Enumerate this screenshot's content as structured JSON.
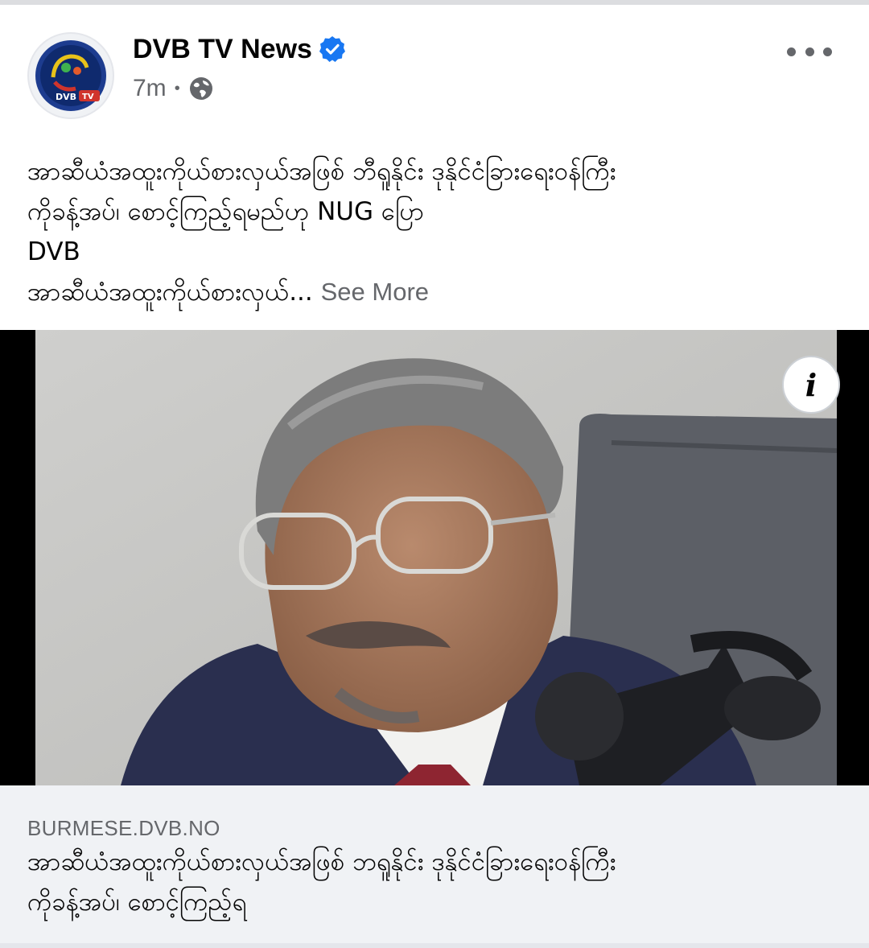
{
  "post": {
    "page_name": "DVB TV News",
    "verified_icon": "verified-badge-icon",
    "time": "7m",
    "separator": "•",
    "audience_icon": "globe-icon",
    "more_icon": "more-options-icon",
    "avatar_text": "DVB",
    "avatar_badge": "TV",
    "text_lines": [
      "အာဆီယံအထူးကိုယ်စားလှယ်အဖြစ် ဘီရူနိုင်း ဒုနိုင်ငံခြားရေးဝန်ကြီး",
      "ကိုခန့်အပ်၊ စောင့်ကြည့်ရမည်ဟု NUG ပြော",
      "DVB",
      "အာဆီယံအထူးကိုယ်စားလှယ်..."
    ],
    "see_more": "See More"
  },
  "photo": {
    "info_label": "i"
  },
  "link_preview": {
    "domain": "BURMESE.DVB.NO",
    "title_lines": [
      "အာဆီယံအထူးကိုယ်စားလှယ်အဖြစ် ဘရူနိုင်း ဒုနိုင်ငံခြားရေးဝန်ကြီး",
      "ကိုခန့်အပ်၊ စောင့်ကြည့်ရ"
    ]
  },
  "colors": {
    "primary_text": "#050505",
    "secondary_text": "#65676b",
    "verified_blue": "#1877f2",
    "card_bg": "#f0f2f5"
  }
}
